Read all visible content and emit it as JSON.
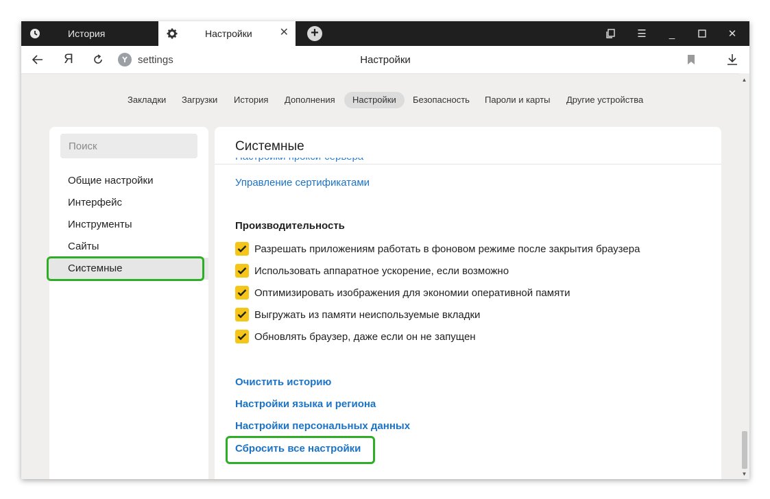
{
  "tabs": [
    {
      "label": "История",
      "icon": "clock-icon",
      "active": false
    },
    {
      "label": "Настройки",
      "icon": "gear-icon",
      "active": true
    }
  ],
  "toolbar": {
    "back_icon": "arrow-left-icon",
    "yandex_logo": "Я",
    "reload_icon": "reload-icon",
    "url": "settings",
    "page_title": "Настройки"
  },
  "topnav": [
    "Закладки",
    "Загрузки",
    "История",
    "Дополнения",
    "Настройки",
    "Безопасность",
    "Пароли и карты",
    "Другие устройства"
  ],
  "topnav_active": "Настройки",
  "sidebar": {
    "search_placeholder": "Поиск",
    "items": [
      "Общие настройки",
      "Интерфейс",
      "Инструменты",
      "Сайты",
      "Системные"
    ],
    "active": "Системные"
  },
  "content": {
    "title": "Системные",
    "cert_link": "Управление сертификатами",
    "perf_header": "Производительность",
    "checkboxes": [
      {
        "label": "Разрешать приложениям работать в фоновом режиме после закрытия браузера",
        "checked": true
      },
      {
        "label": "Использовать аппаратное ускорение, если возможно",
        "checked": true
      },
      {
        "label": "Оптимизировать изображения для экономии оперативной памяти",
        "checked": true
      },
      {
        "label": "Выгружать из памяти неиспользуемые вкладки",
        "checked": true
      },
      {
        "label": "Обновлять браузер, даже если он не запущен",
        "checked": true
      }
    ],
    "links": [
      "Очистить историю",
      "Настройки языка и региона",
      "Настройки персональных данных",
      "Сбросить все настройки"
    ]
  },
  "colors": {
    "accent_highlight": "#2eae25",
    "checkbox": "#f5c518",
    "link": "#1a73c7",
    "tabbar": "#1f1f1f"
  }
}
